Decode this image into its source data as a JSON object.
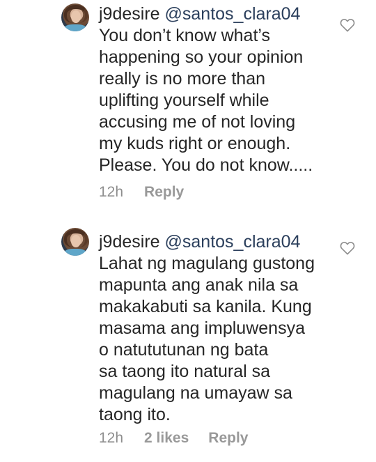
{
  "comments": [
    {
      "username": "j9desire",
      "mention": "@santos_clara04",
      "text": "You don’t know what’s\nhappening so your opinion\nreally is no more than\nuplifting yourself while\naccusing me of not loving\nmy kuds right or enough.\nPlease. You do not know.....",
      "time": "12h",
      "likes": "",
      "reply_label": "Reply"
    },
    {
      "username": "j9desire",
      "mention": "@santos_clara04",
      "text": "Lahat ng magulang gustong\nmapunta ang anak nila sa\nmakakabuti sa kanila. Kung\nmasama ang impluwensya\no natututunan ng bata\nsa taong ito natural sa\nmagulang na umayaw sa\ntaong ito.",
      "time": "12h",
      "likes": "2 likes",
      "reply_label": "Reply"
    }
  ],
  "icons": {
    "like": "heart-outline-icon",
    "avatar": "profile-avatar"
  },
  "colors": {
    "text": "#262626",
    "meta": "#8e8e8e",
    "icon": "#8e8e8e"
  }
}
